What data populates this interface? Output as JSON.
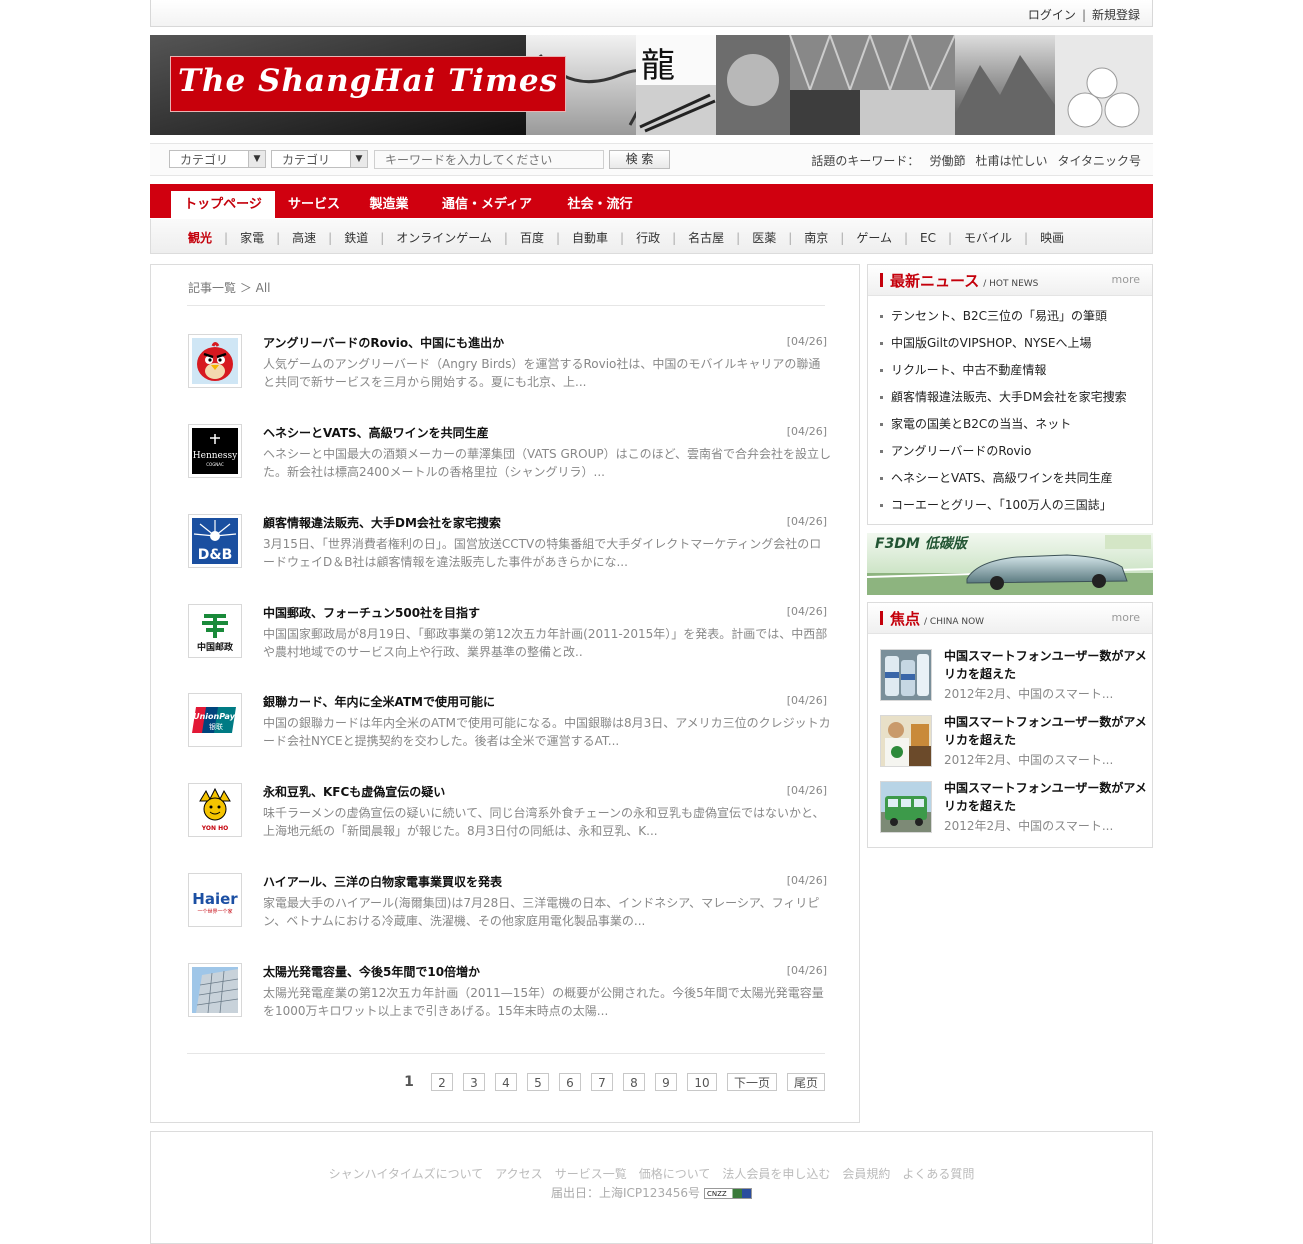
{
  "topbar": {
    "login": "ログイン",
    "separator": "|",
    "register": "新規登録"
  },
  "banner": {
    "logo_text": "The ShangHai Times"
  },
  "search": {
    "category1": "カテゴリ",
    "category2": "カテゴリ",
    "keyword_placeholder": "キーワードを入力してください",
    "button": "検 索",
    "hot_label": "話題のキーワード：",
    "hot_keywords": [
      "労働節",
      "杜甫は忙しい",
      "タイタニック号"
    ]
  },
  "nav": {
    "tabs": [
      "トップページ",
      "サービス",
      "製造業",
      "通信・メディア",
      "社会・流行"
    ]
  },
  "subnav": {
    "items": [
      "観光",
      "家電",
      "高速",
      "鉄道",
      "オンラインゲーム",
      "百度",
      "自動車",
      "行政",
      "名古屋",
      "医薬",
      "南京",
      "ゲーム",
      "EC",
      "モバイル",
      "映画"
    ]
  },
  "breadcrumb": "記事一覧 ＞ All",
  "articles": [
    {
      "title": "アングリーバードのRovio、中国にも進出か",
      "date": "[04/26]",
      "body": "人気ゲームのアングリーバード（Angry Birds）を運営するRovio社は、中国のモバイルキャリアの聯通と共同で新サービスを三月から開始する。夏にも北京、上...",
      "icon": "angry-bird-icon"
    },
    {
      "title": "ヘネシーとVATS、高級ワインを共同生産",
      "date": "[04/26]",
      "body": "ヘネシーと中国最大の酒類メーカーの華澤集団（VATS GROUP）はこのほど、雲南省で合弁会社を設立した。新会社は標高2400メートルの香格里拉（シャングリラ）...",
      "icon": "hennessy-logo-icon"
    },
    {
      "title": "顧客情報違法販売、大手DM会社を家宅捜索",
      "date": "[04/26]",
      "body": "3月15日、「世界消費者権利の日」。国営放送CCTVの特集番組で大手ダイレクトマーケティング会社のロードウェイD＆B社は顧客情報を違法販売した事件があきらかにな...",
      "icon": "db-logo-icon"
    },
    {
      "title": "中国郵政、フォーチュン500社を目指す",
      "date": "[04/26]",
      "body": "中国国家郵政局が8月19日、「郵政事業の第12次五カ年計画(2011-2015年）」を発表。計画では、中西部や農村地域でのサービス向上や行政、業界基準の整備と改..",
      "icon": "china-post-logo-icon"
    },
    {
      "title": "銀聯カード、年内に全米ATMで使用可能に",
      "date": "[04/26]",
      "body": "中国の銀聯カードは年内全米のATMで使用可能になる。中国銀聯は8月3日、アメリカ三位のクレジットカード会社NYCEと提携契約を交わした。後者は全米で運営するAT...",
      "icon": "unionpay-logo-icon"
    },
    {
      "title": "永和豆乳、KFCも虚偽宣伝の疑い",
      "date": "[04/26]",
      "body": "味千ラーメンの虚偽宣伝の疑いに続いて、同じ台湾系外食チェーンの永和豆乳も虚偽宣伝ではないかと、上海地元紙の「新聞晨報」が報じた。8月3日付の同紙は、永和豆乳、K...",
      "icon": "yonho-logo-icon"
    },
    {
      "title": "ハイアール、三洋の白物家電事業買収を発表",
      "date": "[04/26]",
      "body": "家電最大手のハイアール(海爾集団)は7月28日、三洋電機の日本、インドネシア、マレーシア、フィリピン、ベトナムにおける冷蔵庫、洗濯機、その他家庭用電化製品事業の...",
      "icon": "haier-logo-icon"
    },
    {
      "title": "太陽光発電容量、今後5年間で10倍増か",
      "date": "[04/26]",
      "body": "太陽光発電産業の第12次五カ年計画（2011—15年）の概要が公開された。今後5年間で太陽光発電容量を1000万キロワット以上まで引きあげる。15年末時点の太陽...",
      "icon": "solar-panel-icon"
    }
  ],
  "pager": {
    "current": "1",
    "pages": [
      "2",
      "3",
      "4",
      "5",
      "6",
      "7",
      "8",
      "9",
      "10"
    ],
    "next": "下一页",
    "last": "尾页"
  },
  "latest": {
    "title": "最新ニュース",
    "subtitle": "/ HOT NEWS",
    "more": "more",
    "items": [
      "テンセント、B2C三位の「易迅」の筆頭",
      "中国版GiltのVIPSHOP、NYSEへ上場",
      "リクルート、中古不動産情報",
      "顧客情報違法販売、大手DM会社を家宅捜索",
      "家電の国美とB2Cの当当、ネット",
      "アングリーバードのRovio",
      "ヘネシーとVATS、高級ワインを共同生産",
      "コーエーとグリー、「100万人の三国誌」"
    ]
  },
  "ad": {
    "text": "F3DM 低碳版"
  },
  "focus": {
    "title": "焦点",
    "subtitle": "/ CHINA NOW",
    "more": "more",
    "items": [
      {
        "title": "中国スマートフォンユーザー数がアメリカを超えた",
        "sub": "2012年2月、中国のスマート..."
      },
      {
        "title": "中国スマートフォンユーザー数がアメリカを超えた",
        "sub": "2012年2月、中国のスマート..."
      },
      {
        "title": "中国スマートフォンユーザー数がアメリカを超えた",
        "sub": "2012年2月、中国のスマート..."
      }
    ]
  },
  "footer": {
    "links": [
      "シャンハイタイムズについて",
      "アクセス",
      "サービス一覧",
      "価格について",
      "法人会員を申し込む",
      "会員規約",
      "よくある質問"
    ],
    "icp": "届出日：上海ICP123456号",
    "cnzz": "CNZZ"
  },
  "colors": {
    "brand_red": "#d0000f",
    "accent_red": "#c4000b"
  }
}
